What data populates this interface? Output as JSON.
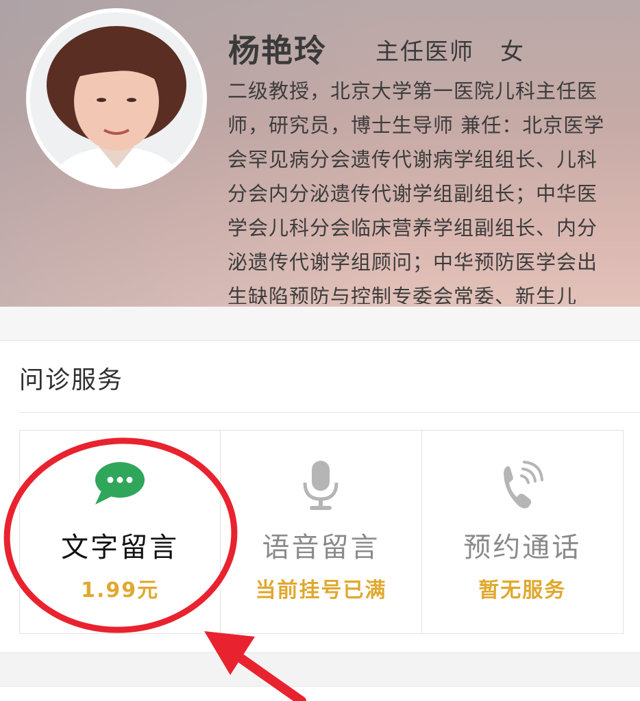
{
  "doctor": {
    "name": "杨艳玲",
    "title": "主任医师",
    "gender": "女",
    "bio": "二级教授，北京大学第一医院儿科主任医师，研究员，博士生导师 兼任：北京医学会罕见病分会遗传代谢病学组组长、儿科分会内分泌遗传代谢学组副组长；中华医学会儿科分会临床营养学组副组长、内分泌遗传代谢学组顾问；中华预防医学会出生缺陷预防与控制专委会常委、新生儿"
  },
  "consult": {
    "section_title": "问诊服务",
    "services": [
      {
        "name": "文字留言",
        "status": "1.99元",
        "icon": "chat-bubble-icon",
        "active": true
      },
      {
        "name": "语音留言",
        "status": "当前挂号已满",
        "icon": "microphone-icon",
        "active": false
      },
      {
        "name": "预约通话",
        "status": "暂无服务",
        "icon": "phone-icon",
        "active": false
      }
    ]
  },
  "colors": {
    "accent_green": "#2fa65a",
    "status_gold": "#e0a82e",
    "annotation_red": "#e8232f",
    "active_text": "#111111",
    "inactive_text": "#8a8a8a",
    "inactive_icon": "#b5b5b5"
  }
}
